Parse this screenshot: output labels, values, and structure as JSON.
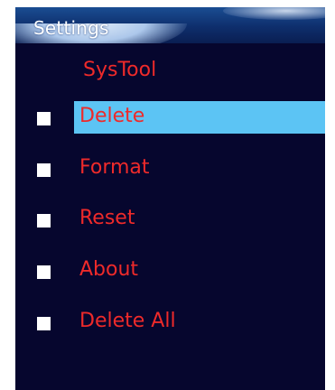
{
  "header": {
    "title": "Settings"
  },
  "menu": {
    "heading": "SysTool",
    "selected_index": 0,
    "items": [
      {
        "label": "Delete",
        "selected": true
      },
      {
        "label": "Format",
        "selected": false
      },
      {
        "label": "Reset",
        "selected": false
      },
      {
        "label": "About",
        "selected": false
      },
      {
        "label": "Delete All",
        "selected": false
      }
    ]
  },
  "colors": {
    "background": "#06062e",
    "text": "#ee2a2a",
    "highlight": "#5cc4f4",
    "bullet": "#ffffff",
    "title_text": "#ffffff"
  },
  "icons": {
    "bullet": "square-bullet-icon"
  }
}
